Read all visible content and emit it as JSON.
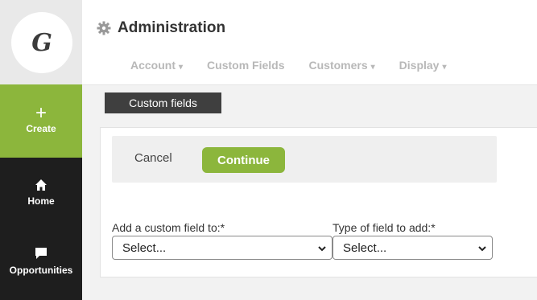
{
  "logo": {
    "letter": "G"
  },
  "sidebar": {
    "create_label": "Create",
    "home_label": "Home",
    "opportunities_label": "Opportunities"
  },
  "header": {
    "title": "Administration",
    "tabs": [
      {
        "label": "Account",
        "dropdown": true
      },
      {
        "label": "Custom Fields",
        "dropdown": false
      },
      {
        "label": "Customers",
        "dropdown": true
      },
      {
        "label": "Display",
        "dropdown": true
      }
    ]
  },
  "section": {
    "label": "Custom fields"
  },
  "form": {
    "cancel_label": "Cancel",
    "continue_label": "Continue",
    "add_to": {
      "label": "Add a custom field to:*",
      "value": "Select..."
    },
    "field_type": {
      "label": "Type of field to add:*",
      "value": "Select..."
    }
  },
  "colors": {
    "accent_green": "#8cb63c",
    "sidebar_dark": "#1e1e1e",
    "section_label_bg": "#3f3f3f"
  }
}
